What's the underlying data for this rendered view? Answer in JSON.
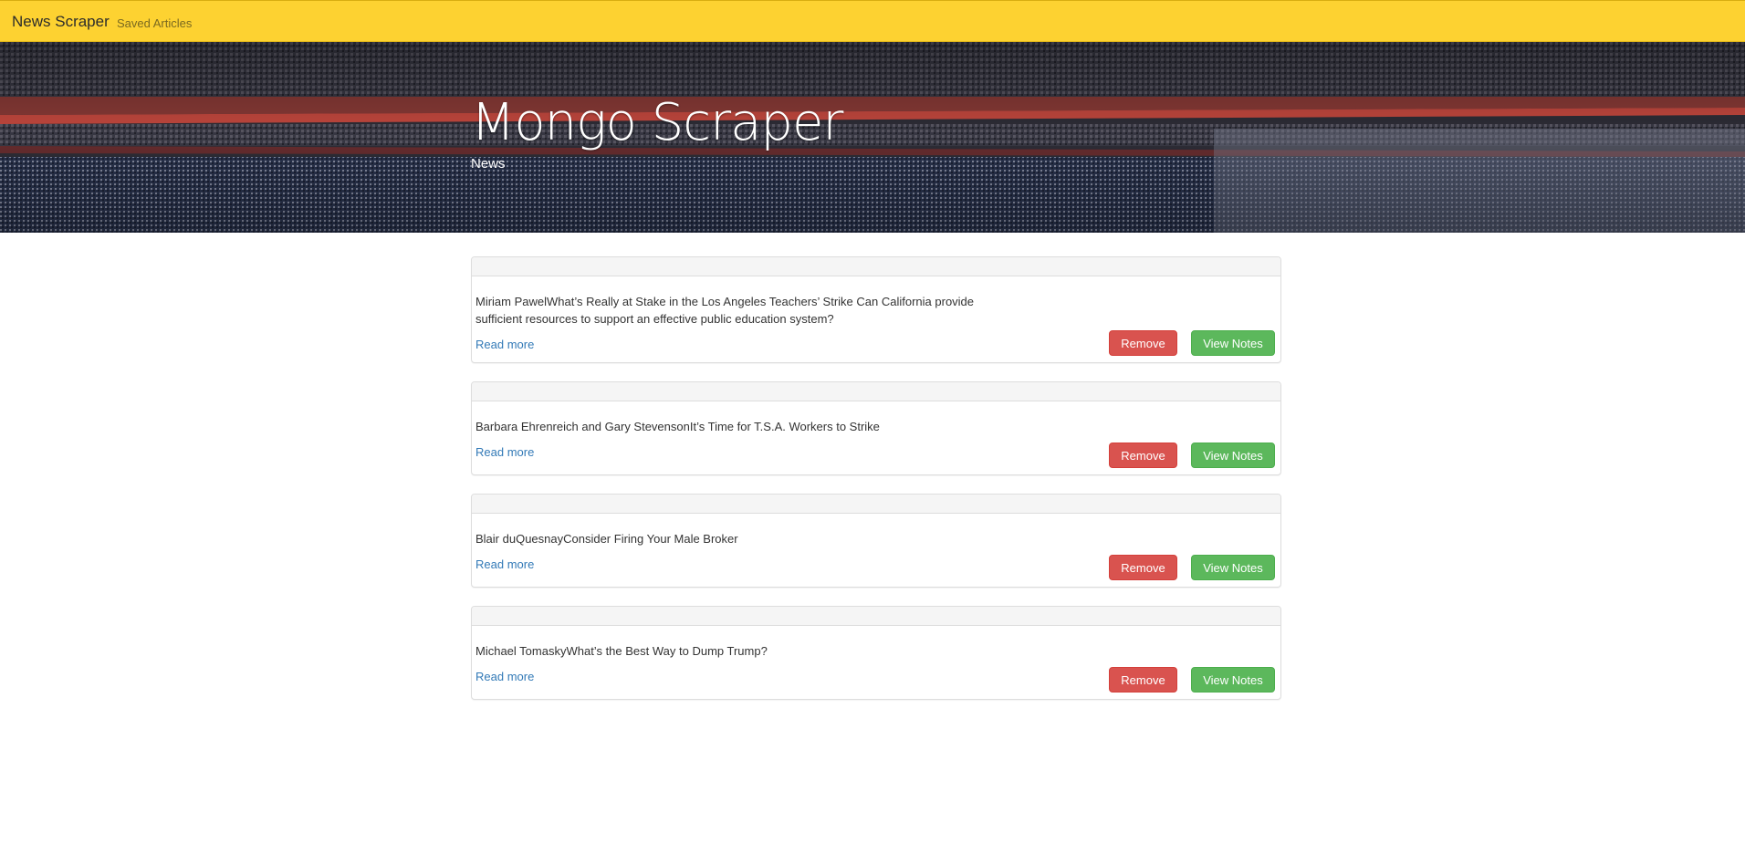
{
  "navbar": {
    "brand": "News Scraper",
    "saved_link": "Saved Articles",
    "bg_color": "#fdd231"
  },
  "hero": {
    "title": "Mongo Scraper",
    "subtitle": "News"
  },
  "articles": [
    {
      "headline": "Miriam PawelWhat’s Really at Stake in the Los Angeles Teachers’ Strike Can California provide sufficient resources to support an effective public education system?",
      "read_more": "Read more",
      "remove_label": "Remove",
      "notes_label": "View Notes"
    },
    {
      "headline": "Barbara Ehrenreich and Gary StevensonIt’s Time for T.S.A. Workers to Strike",
      "read_more": "Read more",
      "remove_label": "Remove",
      "notes_label": "View Notes"
    },
    {
      "headline": "Blair duQuesnayConsider Firing Your Male Broker",
      "read_more": "Read more",
      "remove_label": "Remove",
      "notes_label": "View Notes"
    },
    {
      "headline": "Michael TomaskyWhat’s the Best Way to Dump Trump?",
      "read_more": "Read more",
      "remove_label": "Remove",
      "notes_label": "View Notes"
    }
  ],
  "colors": {
    "remove": "#d9534f",
    "notes": "#5cb85c",
    "link": "#337ab7"
  }
}
